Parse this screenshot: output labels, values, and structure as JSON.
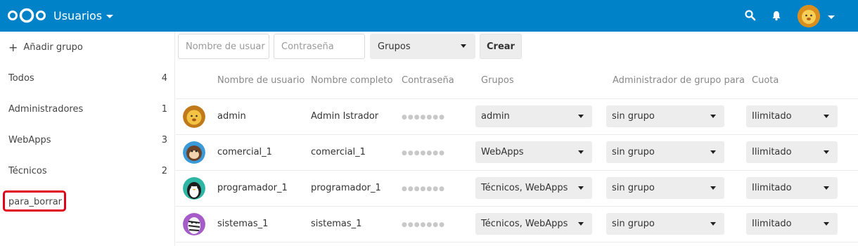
{
  "header": {
    "app_title": "Usuarios",
    "icons": [
      "nextcloud-logo",
      "search-icon",
      "notifications-icon",
      "user-avatar",
      "chevron-down-icon"
    ],
    "accent": "#0082c9"
  },
  "sidebar": {
    "add_group": "Añadir grupo",
    "groups": [
      {
        "label": "Todos",
        "count": "4"
      },
      {
        "label": "Administradores",
        "count": "1"
      },
      {
        "label": "WebApps",
        "count": "3"
      },
      {
        "label": "Técnicos",
        "count": "2"
      },
      {
        "label": "para_borrar",
        "count": ""
      }
    ],
    "highlight_color": "#e0001a"
  },
  "new_user_form": {
    "username_placeholder": "Nombre de usuar",
    "password_placeholder": "Contraseña",
    "groups_label": "Grupos",
    "create_label": "Crear"
  },
  "table": {
    "columns": [
      "Nombre de usuario",
      "Nombre completo",
      "Contraseña",
      "Grupos",
      "Administrador de grupo para",
      "Cuota"
    ],
    "rows": [
      {
        "username": "admin",
        "fullname": "Admin Istrador",
        "password": "●●●●●●●",
        "groups": "admin",
        "subadmin": "sin grupo",
        "quota": "Ilimitado",
        "avatar": "lion"
      },
      {
        "username": "comercial_1",
        "fullname": "comercial_1",
        "password": "●●●●●●●",
        "groups": "WebApps",
        "subadmin": "sin grupo",
        "quota": "Ilimitado",
        "avatar": "monkey"
      },
      {
        "username": "programador_1",
        "fullname": "programador_1",
        "password": "●●●●●●●",
        "groups": "Técnicos, WebApps",
        "subadmin": "sin grupo",
        "quota": "Ilimitado",
        "avatar": "penguin"
      },
      {
        "username": "sistemas_1",
        "fullname": "sistemas_1",
        "password": "●●●●●●●",
        "groups": "Técnicos, WebApps",
        "subadmin": "sin grupo",
        "quota": "Ilimitado",
        "avatar": "zebra"
      }
    ]
  }
}
